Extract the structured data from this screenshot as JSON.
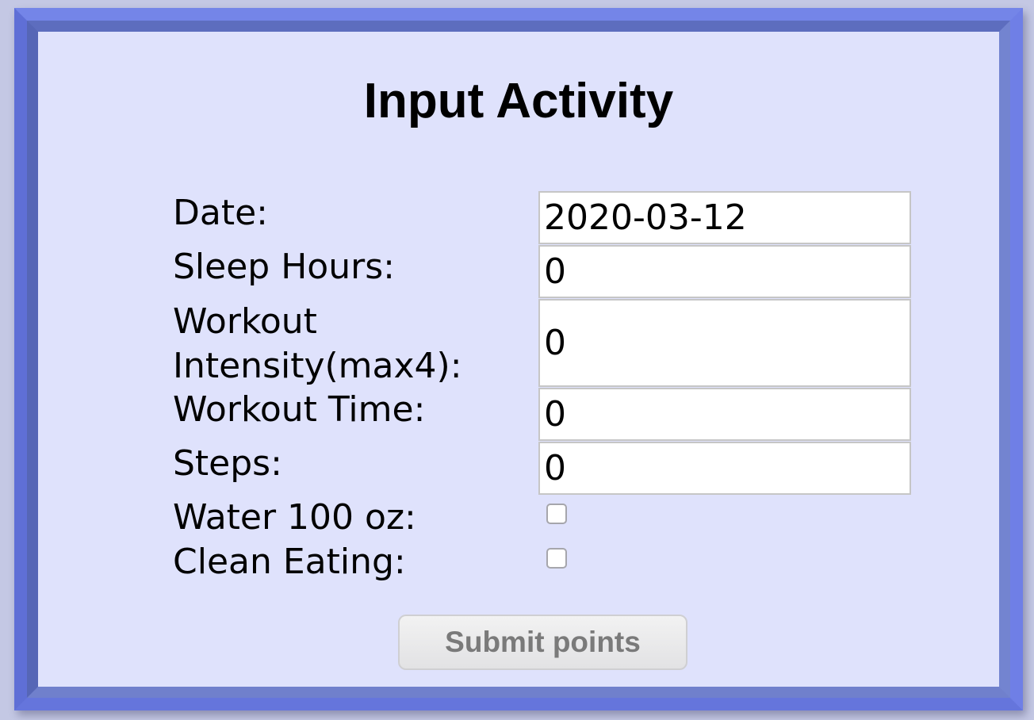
{
  "form": {
    "title": "Input Activity",
    "fields": {
      "date": {
        "label": "Date:",
        "value": "2020-03-12"
      },
      "sleep_hours": {
        "label": "Sleep Hours:",
        "value": "0"
      },
      "workout_intensity": {
        "label_line1": "Workout",
        "label_line2": "Intensity(max4):",
        "value": "0"
      },
      "workout_time": {
        "label": "Workout Time:",
        "value": "0"
      },
      "steps": {
        "label": "Steps:",
        "value": "0"
      },
      "water": {
        "label": "Water 100 oz:",
        "checked": false
      },
      "clean_eating": {
        "label": "Clean Eating:",
        "checked": false
      }
    },
    "submit_label": "Submit points"
  },
  "colors": {
    "page_background": "#c4c8e4",
    "outer_border": "#6878e0",
    "inner_border": "#6475c6",
    "panel_background": "#dfe2fc",
    "button_text": "#7a7a7a"
  }
}
